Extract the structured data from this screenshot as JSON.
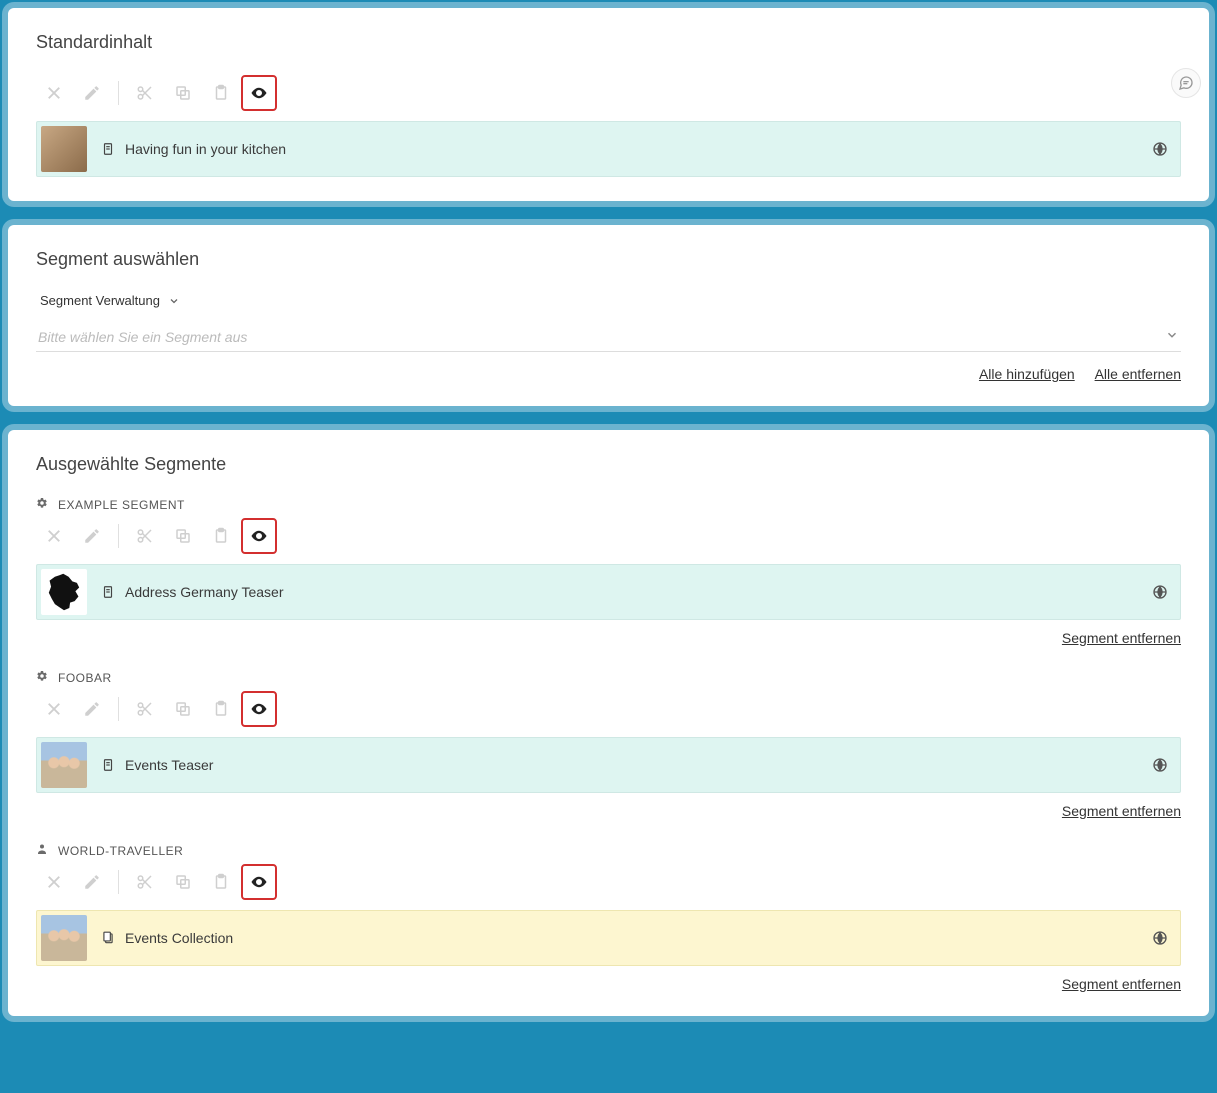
{
  "panels": {
    "default_content": {
      "title": "Standardinhalt",
      "item": {
        "label": "Having fun in your kitchen",
        "variant": "teal",
        "thumb": "kitchen"
      }
    },
    "select_segment": {
      "title": "Segment auswählen",
      "admin_label": "Segment Verwaltung",
      "placeholder": "Bitte wählen Sie ein Segment aus",
      "add_all": "Alle hinzufügen",
      "remove_all": "Alle entfernen"
    },
    "selected_segments": {
      "title": "Ausgewählte Segmente",
      "remove_label": "Segment entfernen",
      "segments": [
        {
          "name": "EXAMPLE SEGMENT",
          "icon": "gear",
          "item": {
            "label": "Address Germany Teaser",
            "variant": "teal",
            "thumb": "germany",
            "doc": "single"
          }
        },
        {
          "name": "FOOBAR",
          "icon": "gear",
          "item": {
            "label": "Events Teaser",
            "variant": "teal",
            "thumb": "people",
            "doc": "single"
          }
        },
        {
          "name": "WORLD-TRAVELLER",
          "icon": "person",
          "item": {
            "label": "Events Collection",
            "variant": "yellow",
            "thumb": "people",
            "doc": "stack"
          }
        }
      ]
    }
  }
}
